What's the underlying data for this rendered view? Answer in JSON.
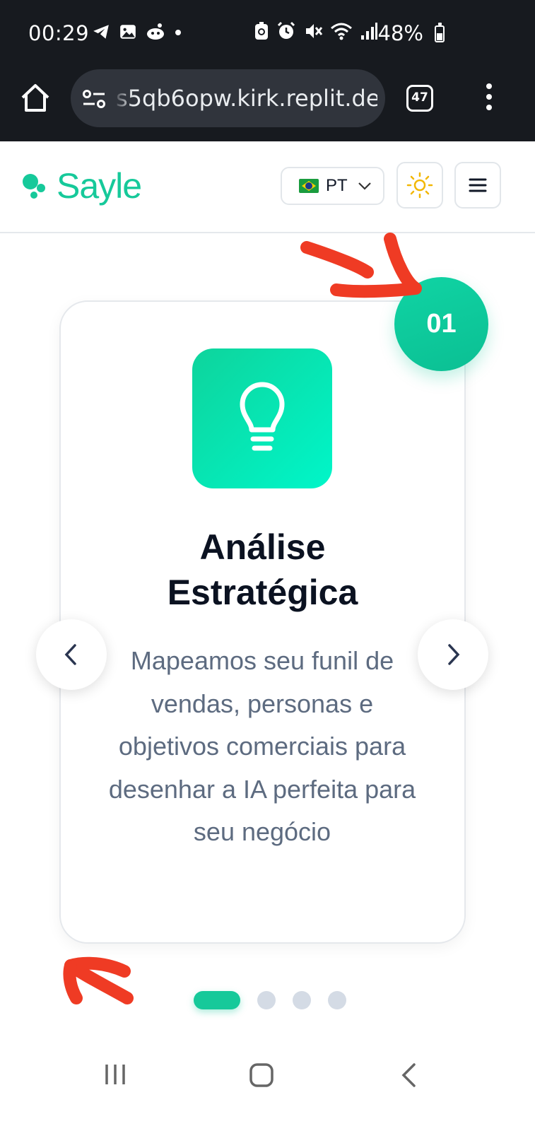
{
  "status_bar": {
    "time": "00:29",
    "battery": "48%"
  },
  "browser": {
    "url": "s5qb6opw.kirk.replit.dev",
    "tab_count": "47"
  },
  "header": {
    "logo_text": "Sayle",
    "language": "PT",
    "accent_color": "#16c99a"
  },
  "card": {
    "step_number": "01",
    "title_line1": "Análise",
    "title_line2": "Estratégica",
    "description": "Mapeamos seu funil de vendas, personas e objetivos comerciais para desenhar a IA perfeita para seu negócio",
    "icon": "lightbulb-icon"
  },
  "carousel": {
    "active_index": 0,
    "total": 4
  }
}
